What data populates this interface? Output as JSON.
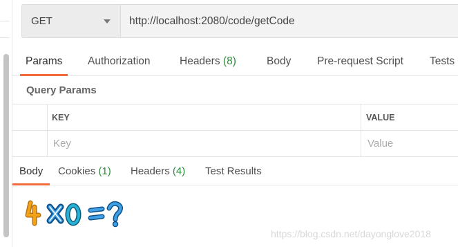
{
  "request": {
    "method": "GET",
    "url": "http://localhost:2080/code/getCode"
  },
  "request_tabs": [
    {
      "label": "Params",
      "count": ""
    },
    {
      "label": "Authorization",
      "count": ""
    },
    {
      "label": "Headers",
      "count": "(8)"
    },
    {
      "label": "Body",
      "count": ""
    },
    {
      "label": "Pre-request Script",
      "count": ""
    },
    {
      "label": "Tests",
      "count": ""
    }
  ],
  "query_params": {
    "title": "Query Params",
    "key_header": "KEY",
    "value_header": "VALUE",
    "key_placeholder": "Key",
    "value_placeholder": "Value"
  },
  "response_tabs": [
    {
      "label": "Body",
      "count": ""
    },
    {
      "label": "Cookies",
      "count": "(1)"
    },
    {
      "label": "Headers",
      "count": "(4)"
    },
    {
      "label": "Test Results",
      "count": ""
    }
  ],
  "captcha": {
    "characters": [
      "4",
      "x",
      "0",
      "=",
      "?"
    ],
    "colors": {
      "four": "#f2a31a",
      "cross": "#1f7fc8",
      "zero": "#1a8fb0",
      "equals": "#1f7fc8",
      "question": "#1f7fc8"
    }
  },
  "watermark": "https://blog.csdn.net/dayonglove2018",
  "colors": {
    "accent": "#f26b3a",
    "count": "#2e8b3e"
  }
}
